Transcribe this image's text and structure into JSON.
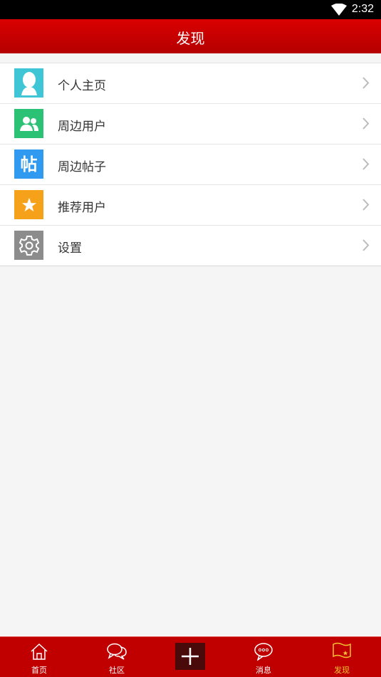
{
  "status_bar": {
    "time": "2:32",
    "wifi_icon": "wifi-icon"
  },
  "header": {
    "title": "发现"
  },
  "menu": {
    "items": [
      {
        "label": "个人主页",
        "icon": "person-icon",
        "color": "#3ec6d6"
      },
      {
        "label": "周边用户",
        "icon": "users-icon",
        "color": "#2bc276"
      },
      {
        "label": "周边帖子",
        "icon": "post-icon",
        "icon_text": "帖",
        "color": "#2f9af0"
      },
      {
        "label": "推荐用户",
        "icon": "star-icon",
        "color": "#f5a21a"
      },
      {
        "label": "设置",
        "icon": "gear-icon",
        "color": "#8c8c8c"
      }
    ]
  },
  "tab_bar": {
    "tabs": [
      {
        "label": "首页",
        "icon": "home-icon"
      },
      {
        "label": "社区",
        "icon": "chat-bubbles-icon"
      },
      {
        "label": "",
        "icon": "plus-icon"
      },
      {
        "label": "消息",
        "icon": "message-icon"
      },
      {
        "label": "发现",
        "icon": "flag-icon",
        "active": true
      }
    ],
    "background": "#c00000",
    "active_color": "#f4c430"
  }
}
